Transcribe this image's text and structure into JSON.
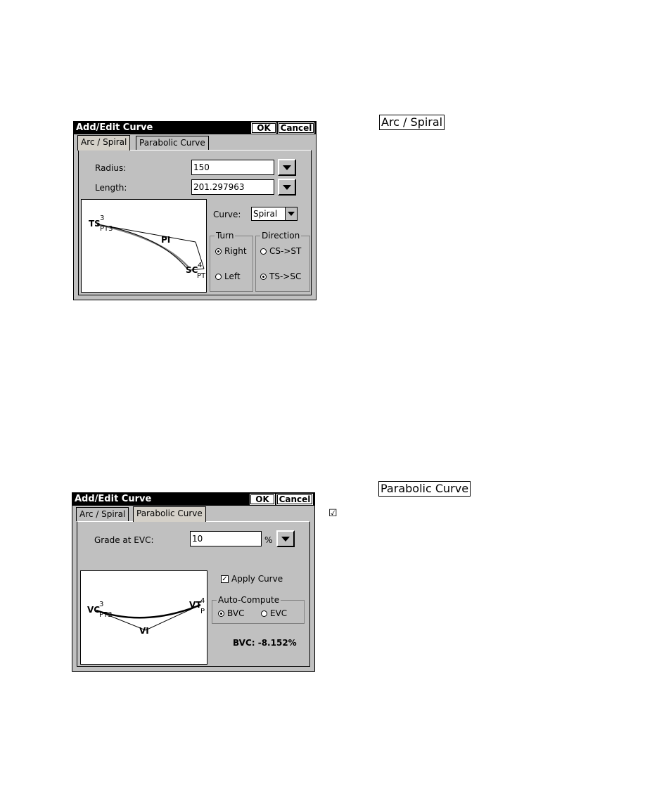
{
  "dialog1": {
    "title": "Add/Edit Curve",
    "ok_label": "OK",
    "cancel_label": "Cancel",
    "tabs": [
      {
        "label": "Arc / Spiral",
        "active": true
      },
      {
        "label": "Parabolic Curve",
        "active": false
      }
    ],
    "radius_label": "Radius:",
    "radius_value": "150",
    "length_label": "Length:",
    "length_value": "201.297963",
    "curve_label": "Curve:",
    "curve_value": "Spiral",
    "turn_group": "Turn",
    "turn_right": "Right",
    "turn_left": "Left",
    "direction_group": "Direction",
    "dir_cs_st": "CS->ST",
    "dir_ts_sc": "TS->SC",
    "diagram": {
      "ts": "TS",
      "ts_num": "3",
      "ts_pt": "PT3",
      "pi": "PI",
      "sc": "SC",
      "sc_num": "4",
      "sc_pt": "PT"
    }
  },
  "dialog2": {
    "title": "Add/Edit Curve",
    "ok_label": "OK",
    "cancel_label": "Cancel",
    "tabs": [
      {
        "label": "Arc / Spiral",
        "active": false
      },
      {
        "label": "Parabolic Curve",
        "active": true
      }
    ],
    "grade_label": "Grade at EVC:",
    "grade_value": "10",
    "grade_unit": "%",
    "apply_curve": "Apply  Curve",
    "auto_group": "Auto-Compute",
    "opt_bvc": "BVC",
    "opt_evc": "EVC",
    "bvc_result": "BVC: -8.152%",
    "diagram": {
      "vc": "VC",
      "vc_num": "3",
      "vc_pt": "PT3",
      "vi": "VI",
      "vt": "VT",
      "vt_num": "4",
      "vt_p": "P"
    }
  },
  "side": {
    "arc_label": "Arc / Spiral",
    "parabolic_label": "Parabolic Curve",
    "check_glyph": "☑"
  }
}
